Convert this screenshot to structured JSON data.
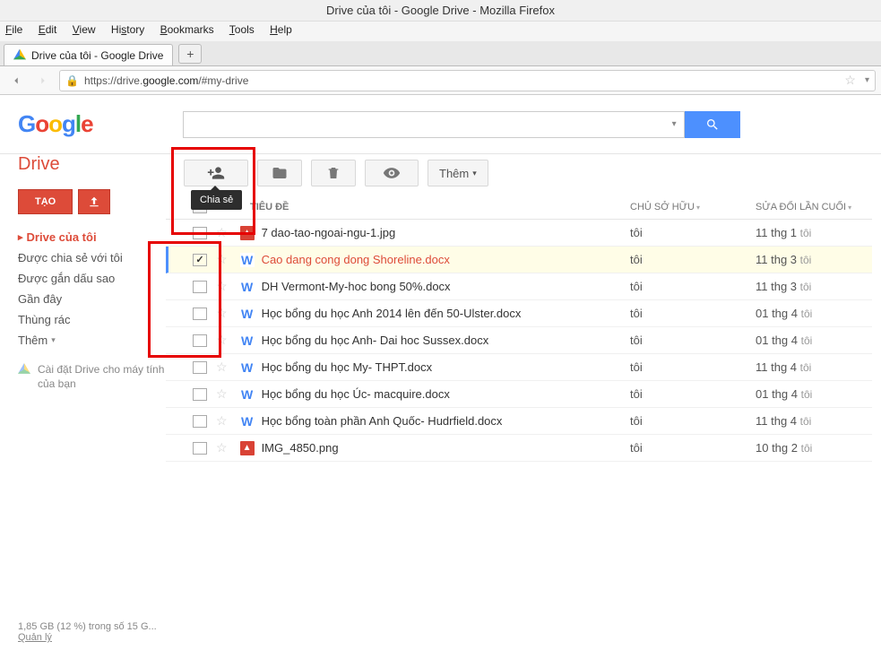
{
  "window": {
    "title": "Drive của tôi - Google Drive - Mozilla Firefox"
  },
  "menu": {
    "file": "File",
    "edit": "Edit",
    "view": "View",
    "history": "History",
    "bookmarks": "Bookmarks",
    "tools": "Tools",
    "help": "Help"
  },
  "tab": {
    "title": "Drive của tôi - Google Drive"
  },
  "url": {
    "prefix": "https://drive.",
    "bold": "google.com",
    "suffix": "/#my-drive"
  },
  "logo": {
    "g1": "G",
    "o1": "o",
    "o2": "o",
    "g2": "g",
    "l": "l",
    "e": "e"
  },
  "app": {
    "title": "Drive"
  },
  "sidebar": {
    "create": "TẠO",
    "items": [
      "Drive của tôi",
      "Được chia sẻ với tôi",
      "Được gắn dấu sao",
      "Gần đây",
      "Thùng rác"
    ],
    "more": "Thêm",
    "install": "Cài đặt Drive cho máy tính của bạn"
  },
  "toolbar": {
    "share_tooltip": "Chia sẻ",
    "more": "Thêm"
  },
  "columns": {
    "title": "TIÊU ĐỀ",
    "owner": "CHỦ SỞ HỮU",
    "modified": "SỬA ĐỔI LẦN CUỐI"
  },
  "files": [
    {
      "icon": "img",
      "glyph": "▲",
      "name": "7 dao-tao-ngoai-ngu-1.jpg",
      "owner": "tôi",
      "date": "11 thg 1",
      "who": "tôi",
      "selected": false
    },
    {
      "icon": "doc",
      "glyph": "W",
      "name": "Cao dang cong dong Shoreline.docx",
      "owner": "tôi",
      "date": "11 thg 3",
      "who": "tôi",
      "selected": true
    },
    {
      "icon": "doc",
      "glyph": "W",
      "name": "DH Vermont-My-hoc bong 50%.docx",
      "owner": "tôi",
      "date": "11 thg 3",
      "who": "tôi",
      "selected": false
    },
    {
      "icon": "doc",
      "glyph": "W",
      "name": "Học bổng du học Anh 2014 lên đến 50-Ulster.docx",
      "owner": "tôi",
      "date": "01 thg 4",
      "who": "tôi",
      "selected": false
    },
    {
      "icon": "doc",
      "glyph": "W",
      "name": "Học bổng du học Anh- Dai hoc Sussex.docx",
      "owner": "tôi",
      "date": "01 thg 4",
      "who": "tôi",
      "selected": false
    },
    {
      "icon": "doc",
      "glyph": "W",
      "name": "Học bổng du học My- THPT.docx",
      "owner": "tôi",
      "date": "11 thg 4",
      "who": "tôi",
      "selected": false
    },
    {
      "icon": "doc",
      "glyph": "W",
      "name": "Học bổng du học Úc- macquire.docx",
      "owner": "tôi",
      "date": "01 thg 4",
      "who": "tôi",
      "selected": false
    },
    {
      "icon": "doc",
      "glyph": "W",
      "name": "Học bổng toàn phần Anh Quốc- Hudrfield.docx",
      "owner": "tôi",
      "date": "11 thg 4",
      "who": "tôi",
      "selected": false
    },
    {
      "icon": "img",
      "glyph": "▲",
      "name": "IMG_4850.png",
      "owner": "tôi",
      "date": "10 thg 2",
      "who": "tôi",
      "selected": false
    }
  ],
  "quota": {
    "text": "1,85 GB (12 %) trong số 15 G...",
    "manage": "Quản lý"
  }
}
